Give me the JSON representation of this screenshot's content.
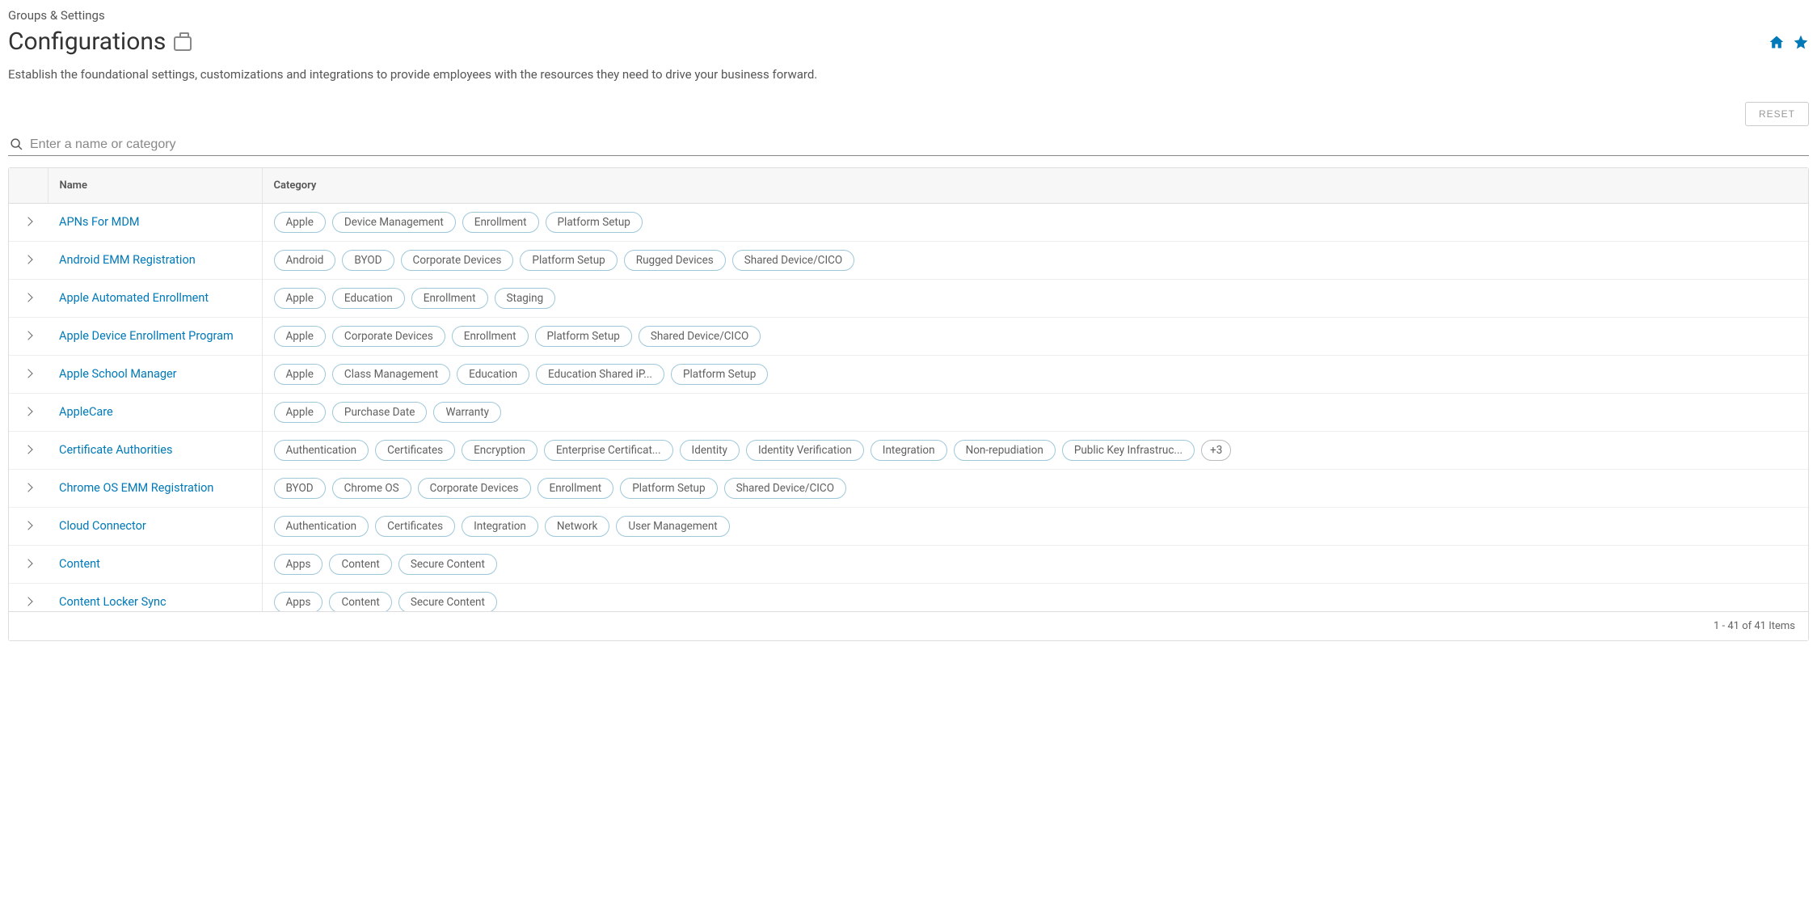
{
  "breadcrumb": "Groups & Settings",
  "page_title": "Configurations",
  "description": "Establish the foundational settings, customizations and integrations to provide employees with the resources they need to drive your business forward.",
  "reset_label": "RESET",
  "search_placeholder": "Enter a name or category",
  "columns": {
    "name": "Name",
    "category": "Category"
  },
  "footer": "1 - 41 of 41 Items",
  "rows": [
    {
      "name": "APNs For MDM",
      "tags": [
        "Apple",
        "Device Management",
        "Enrollment",
        "Platform Setup"
      ]
    },
    {
      "name": "Android EMM Registration",
      "tags": [
        "Android",
        "BYOD",
        "Corporate Devices",
        "Platform Setup",
        "Rugged Devices",
        "Shared Device/CICO"
      ]
    },
    {
      "name": "Apple Automated Enrollment",
      "tags": [
        "Apple",
        "Education",
        "Enrollment",
        "Staging"
      ]
    },
    {
      "name": "Apple Device Enrollment Program",
      "tags": [
        "Apple",
        "Corporate Devices",
        "Enrollment",
        "Platform Setup",
        "Shared Device/CICO"
      ]
    },
    {
      "name": "Apple School Manager",
      "tags": [
        "Apple",
        "Class Management",
        "Education",
        "Education Shared iP...",
        "Platform Setup"
      ]
    },
    {
      "name": "AppleCare",
      "tags": [
        "Apple",
        "Purchase Date",
        "Warranty"
      ]
    },
    {
      "name": "Certificate Authorities",
      "tags": [
        "Authentication",
        "Certificates",
        "Encryption",
        "Enterprise Certificat...",
        "Identity",
        "Identity Verification",
        "Integration",
        "Non-repudiation",
        "Public Key Infrastruc..."
      ],
      "more": "+3"
    },
    {
      "name": "Chrome OS EMM Registration",
      "tags": [
        "BYOD",
        "Chrome OS",
        "Corporate Devices",
        "Enrollment",
        "Platform Setup",
        "Shared Device/CICO"
      ]
    },
    {
      "name": "Cloud Connector",
      "tags": [
        "Authentication",
        "Certificates",
        "Integration",
        "Network",
        "User Management"
      ]
    },
    {
      "name": "Content",
      "tags": [
        "Apps",
        "Content",
        "Secure Content"
      ]
    },
    {
      "name": "Content Locker Sync",
      "tags": [
        "Apps",
        "Content",
        "Secure Content"
      ]
    }
  ]
}
